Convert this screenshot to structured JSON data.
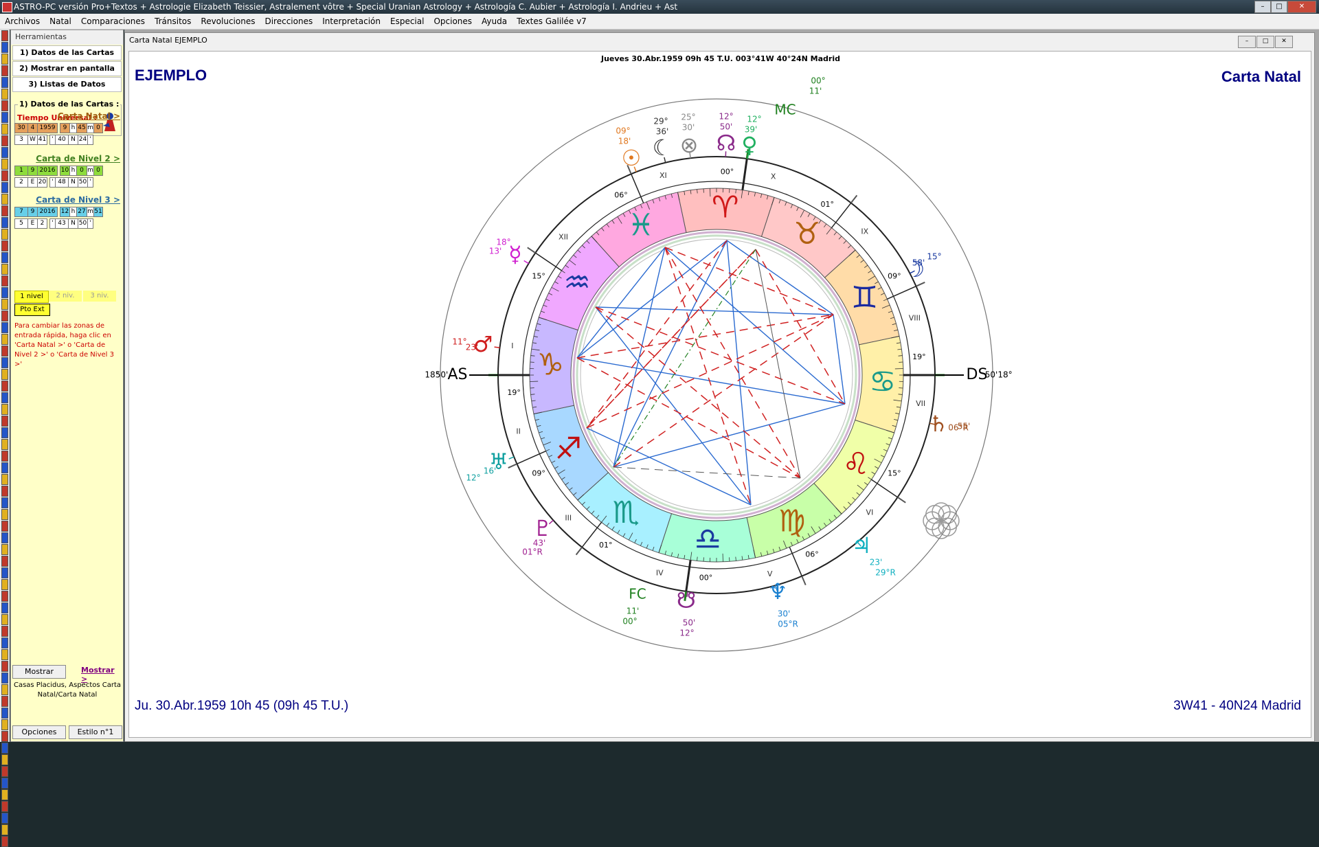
{
  "app_title": "ASTRO-PC versión Pro+Textos + Astrologie Elizabeth Teissier, Astralement vôtre + Special Uranian Astrology + Astrología C. Aubier + Astrología I. Andrieu + Ast",
  "window_buttons": [
    "–",
    "□",
    "✕"
  ],
  "menu": [
    "Archivos",
    "Natal",
    "Comparaciones",
    "Tránsitos",
    "Revoluciones",
    "Direcciones",
    "Interpretación",
    "Especial",
    "Opciones",
    "Ayuda",
    "Textes Galilée v7"
  ],
  "panel": {
    "header": "Herramientas",
    "buttons": [
      "1) Datos de las Cartas",
      "2) Mostrar en pantalla",
      "3) Listas de Datos"
    ],
    "legend": "1) Datos de las Cartas :",
    "tu_label": "Tiempo Universal :",
    "charts": [
      {
        "link": "Carta Natal >",
        "color": "#e5a05c",
        "r1": [
          "30",
          "4",
          "1959",
          "9",
          "h",
          "45",
          "m",
          "0"
        ],
        "r2": [
          "3",
          "W",
          "41",
          "'",
          "40",
          "N",
          "24",
          "'"
        ]
      },
      {
        "link": "Carta de Nivel 2 >",
        "color": "#8edc3c",
        "r1": [
          "1",
          "9",
          "2016",
          "10",
          "h",
          "0",
          "m",
          "0"
        ],
        "r2": [
          "2",
          "E",
          "20",
          "'",
          "48",
          "N",
          "50",
          "'"
        ]
      },
      {
        "link": "Carta de Nivel 3 >",
        "color": "#68cfe8",
        "r1": [
          "7",
          "9",
          "2016",
          "12",
          "h",
          "27",
          "m",
          "51"
        ],
        "r2": [
          "5",
          "E",
          "2",
          "'",
          "43",
          "N",
          "50",
          "'"
        ]
      }
    ],
    "level_buttons": [
      "1 nivel",
      "2 niv.",
      "3 niv."
    ],
    "pto_ext": "Pto Ext",
    "note": "Para cambiar las zonas de entrada rápida, haga clic en 'Carta Natal >' o 'Carta de Nivel 2 >' o 'Carta de Nivel 3 >'",
    "mostrar_btn": "Mostrar",
    "mostrar_link": "Mostrar >",
    "info": "Casas Placidus, Aspectos Carta Natal/Carta Natal",
    "opciones": "Opciones",
    "estilo": "Estilo n°1"
  },
  "child": {
    "title": "Carta Natal  EJEMPLO",
    "header": "Jueves 30.Abr.1959 09h 45 T.U. 003°41W 40°24N  Madrid",
    "name": "EJEMPLO",
    "chart_type": "Carta Natal",
    "footer_left": "Ju. 30.Abr.1959 10h 45 (09h 45 T.U.)",
    "footer_right": "3W41 - 40N24  Madrid"
  },
  "wheel": {
    "asc_label": "AS",
    "asc_deg": "18°",
    "asc_min": "50'",
    "ds_label": "DS",
    "ds_min": "50'",
    "ds_deg": "18°",
    "mc_label": "MC",
    "mc_deg": "00°",
    "mc_min": "11'",
    "fc_label": "FC",
    "fc_min": "11'",
    "fc_deg": "00°",
    "houses": [
      "I",
      "II",
      "III",
      "IV",
      "V",
      "VI",
      "VII",
      "VIII",
      "IX",
      "X",
      "XI",
      "XII"
    ],
    "cusp_degrees": [
      "19°",
      "09°",
      "01°",
      "00°",
      "06°",
      "15°",
      "19°",
      "09°",
      "01°",
      "00°",
      "06°",
      "15°"
    ],
    "sign_colors": [
      "#ffbfbf",
      "#ffc8c8",
      "#ffdca8",
      "#fff0a8",
      "#f0ffa8",
      "#c8ffa8",
      "#a8ffd8",
      "#a8f0ff",
      "#a8d8ff",
      "#c8b8ff",
      "#f0a8ff",
      "#ffa8e0"
    ],
    "planets": [
      {
        "name": "Sol",
        "glyph": "☉",
        "color": "#e07820",
        "deg": "09°",
        "min": "18'"
      },
      {
        "name": "Luna",
        "glyph": "☽",
        "color": "#1a3aa0",
        "deg": "15°",
        "min": "58'"
      },
      {
        "name": "Mercurio",
        "glyph": "☿",
        "color": "#d020d0",
        "deg": "18°",
        "min": "13'"
      },
      {
        "name": "Venus",
        "glyph": "♀",
        "color": "#20b060",
        "deg": "12°",
        "min": "39'"
      },
      {
        "name": "Marte",
        "glyph": "♂",
        "color": "#d02020",
        "deg": "11°",
        "min": "23'"
      },
      {
        "name": "Júpiter",
        "glyph": "♃",
        "color": "#10b0c0",
        "deg": "23'",
        "min": "29°R"
      },
      {
        "name": "Saturno",
        "glyph": "♄",
        "color": "#a05020",
        "deg": "55'",
        "min": "06°R"
      },
      {
        "name": "Urano",
        "glyph": "♅",
        "color": "#10a0a0",
        "deg": "16'",
        "min": "12°"
      },
      {
        "name": "Neptuno",
        "glyph": "♆",
        "color": "#1a80d0",
        "deg": "30'",
        "min": "05°R"
      },
      {
        "name": "Plutón",
        "glyph": "♇",
        "color": "#a02090",
        "deg": "43'",
        "min": "01°R"
      },
      {
        "name": "Nodo Norte",
        "glyph": "☊",
        "color": "#8a2a8a",
        "deg": "12°",
        "min": "50'"
      },
      {
        "name": "Nodo Sur",
        "glyph": "☋",
        "color": "#8a2a8a",
        "deg": "50'",
        "min": "12°"
      },
      {
        "name": "Lilith",
        "glyph": "☾",
        "color": "#333333",
        "deg": "29°",
        "min": "36'"
      },
      {
        "name": "Fortuna",
        "glyph": "⊗",
        "color": "#888888",
        "deg": "25°",
        "min": "30'"
      }
    ]
  }
}
